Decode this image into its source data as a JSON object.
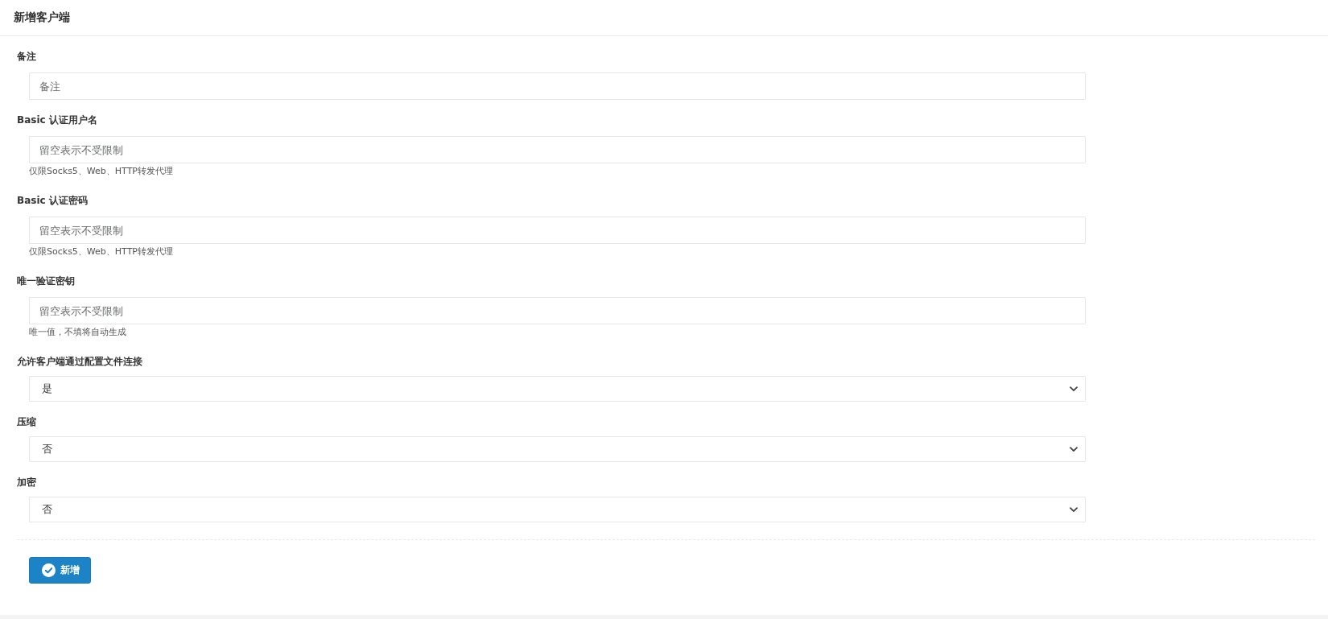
{
  "panel": {
    "title": "新增客户端"
  },
  "fields": [
    {
      "kind": "input",
      "label": "备注",
      "placeholder": "备注"
    },
    {
      "kind": "input",
      "label": "Basic 认证用户名",
      "placeholder": "留空表示不受限制",
      "help": "仅限Socks5、Web、HTTP转发代理"
    },
    {
      "kind": "input",
      "label": "Basic 认证密码",
      "placeholder": "留空表示不受限制",
      "help": "仅限Socks5、Web、HTTP转发代理"
    },
    {
      "kind": "input",
      "label": "唯一验证密钥",
      "placeholder": "留空表示不受限制",
      "help": "唯一值，不填将自动生成"
    },
    {
      "kind": "select",
      "label": "允许客户端通过配置文件连接",
      "value": "是"
    },
    {
      "kind": "select",
      "label": "压缩",
      "value": "否"
    },
    {
      "kind": "select",
      "label": "加密",
      "value": "否"
    }
  ],
  "submit_button": {
    "label": "新增"
  }
}
